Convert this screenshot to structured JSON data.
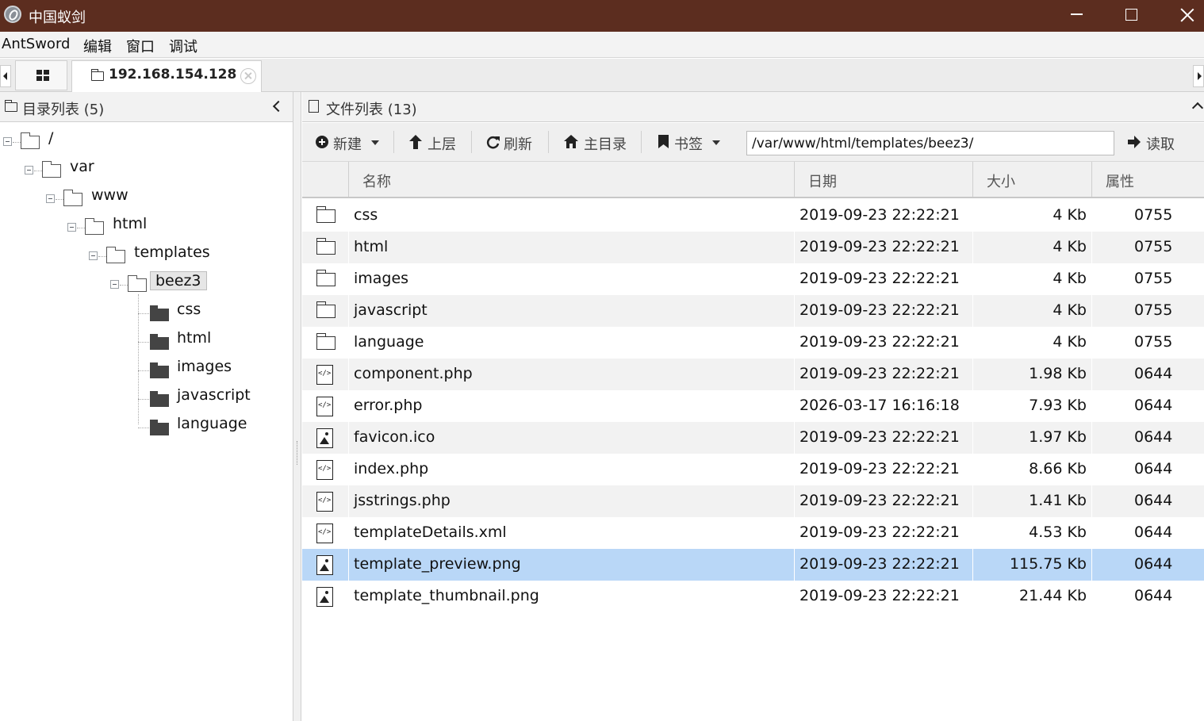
{
  "window": {
    "title": "中国蚁剑"
  },
  "menubar": {
    "items": [
      "AntSword",
      "编辑",
      "窗口",
      "调试"
    ]
  },
  "tabs": {
    "host": "192.168.154.128"
  },
  "left_panel": {
    "title": "目录列表 (5)",
    "tree": [
      {
        "label": "/",
        "depth": 0
      },
      {
        "label": "var",
        "depth": 1
      },
      {
        "label": "www",
        "depth": 2
      },
      {
        "label": "html",
        "depth": 3
      },
      {
        "label": "templates",
        "depth": 4
      },
      {
        "label": "beez3",
        "depth": 5,
        "selected": true
      },
      {
        "label": "css",
        "depth": 6
      },
      {
        "label": "html",
        "depth": 6
      },
      {
        "label": "images",
        "depth": 6
      },
      {
        "label": "javascript",
        "depth": 6
      },
      {
        "label": "language",
        "depth": 6
      }
    ]
  },
  "right_panel": {
    "title": "文件列表 (13)",
    "toolbar": {
      "new_label": "新建",
      "up_label": "上层",
      "refresh_label": "刷新",
      "home_label": "主目录",
      "bookmark_label": "书签",
      "path_value": "/var/www/html/templates/beez3/",
      "read_label": "读取"
    },
    "columns": [
      "名称",
      "日期",
      "大小",
      "属性"
    ],
    "files": [
      {
        "type": "folder",
        "name": "css",
        "date": "2019-09-23 22:22:21",
        "size": "4 Kb",
        "perm": "0755"
      },
      {
        "type": "folder",
        "name": "html",
        "date": "2019-09-23 22:22:21",
        "size": "4 Kb",
        "perm": "0755"
      },
      {
        "type": "folder",
        "name": "images",
        "date": "2019-09-23 22:22:21",
        "size": "4 Kb",
        "perm": "0755"
      },
      {
        "type": "folder",
        "name": "javascript",
        "date": "2019-09-23 22:22:21",
        "size": "4 Kb",
        "perm": "0755"
      },
      {
        "type": "folder",
        "name": "language",
        "date": "2019-09-23 22:22:21",
        "size": "4 Kb",
        "perm": "0755"
      },
      {
        "type": "code",
        "name": "component.php",
        "date": "2019-09-23 22:22:21",
        "size": "1.98 Kb",
        "perm": "0644"
      },
      {
        "type": "code",
        "name": "error.php",
        "date": "2026-03-17 16:16:18",
        "size": "7.93 Kb",
        "perm": "0644"
      },
      {
        "type": "image",
        "name": "favicon.ico",
        "date": "2019-09-23 22:22:21",
        "size": "1.97 Kb",
        "perm": "0644"
      },
      {
        "type": "code",
        "name": "index.php",
        "date": "2019-09-23 22:22:21",
        "size": "8.66 Kb",
        "perm": "0644"
      },
      {
        "type": "code",
        "name": "jsstrings.php",
        "date": "2019-09-23 22:22:21",
        "size": "1.41 Kb",
        "perm": "0644"
      },
      {
        "type": "code",
        "name": "templateDetails.xml",
        "date": "2019-09-23 22:22:21",
        "size": "4.53 Kb",
        "perm": "0644"
      },
      {
        "type": "image",
        "name": "template_preview.png",
        "date": "2019-09-23 22:22:21",
        "size": "115.75 Kb",
        "perm": "0644",
        "selected": true
      },
      {
        "type": "image",
        "name": "template_thumbnail.png",
        "date": "2019-09-23 22:22:21",
        "size": "21.44 Kb",
        "perm": "0644"
      }
    ]
  },
  "colors": {
    "titlebar": "#5c2d1f",
    "selected_row": "#b9d7f7"
  }
}
